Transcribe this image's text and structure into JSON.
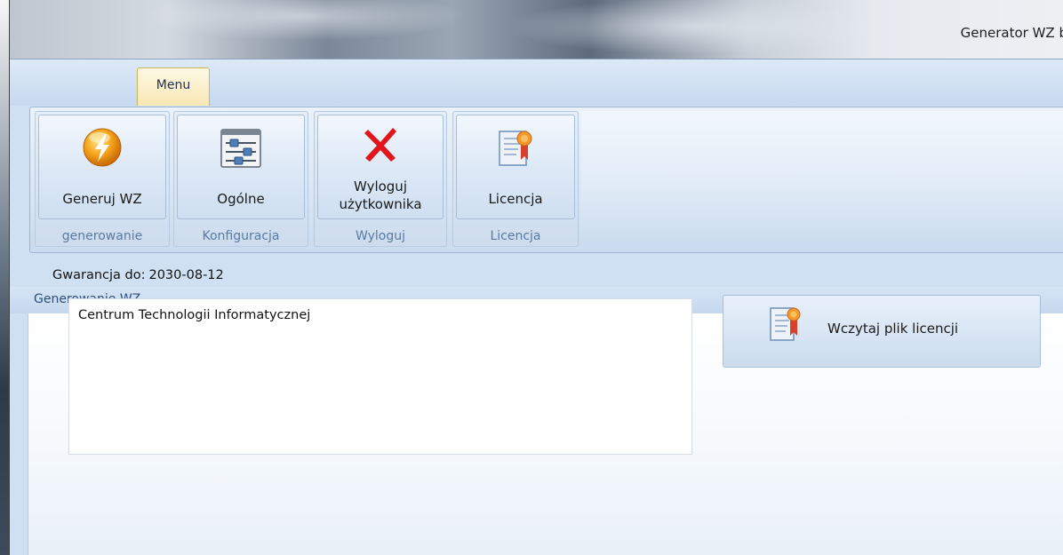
{
  "window": {
    "title": "Generator WZ b"
  },
  "tabs": [
    {
      "label": "Menu",
      "active": true
    }
  ],
  "ribbon": {
    "groups": [
      {
        "button_label": "Generuj WZ",
        "group_label": "generowanie",
        "icon": "lightning-icon"
      },
      {
        "button_label": "Ogólne",
        "group_label": "Konfiguracja",
        "icon": "sliders-icon"
      },
      {
        "button_label": "Wyloguj\nużytkownika",
        "button_line1": "Wyloguj",
        "button_line2": "użytkownika",
        "group_label": "Wyloguj",
        "icon": "red-x-icon"
      },
      {
        "button_label": "Licencja",
        "group_label": "Licencja",
        "icon": "certificate-icon"
      }
    ]
  },
  "section": {
    "title": "Generowanie WZ"
  },
  "license": {
    "warranty_label": "Gwarancja do:",
    "warranty_date": "2030-08-12",
    "licensee_text": "Centrum Technologii Informatycznej",
    "load_button_label": "Wczytaj plik licencji"
  },
  "colors": {
    "ribbon_bg": "#dce8f5",
    "tab_active": "#f7e8b6",
    "group_label": "#5a7aa1",
    "lightning_orange": "#f5a21a",
    "x_red": "#e0161b"
  }
}
